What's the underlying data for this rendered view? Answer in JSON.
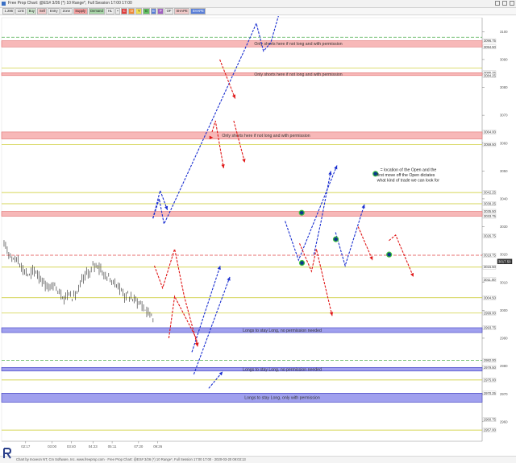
{
  "window": {
    "title": "Free Prop Chart: @ES# 3/26 (*) 10 Range*, Full Session 17:00 17:00"
  },
  "toolbar": [
    {
      "label": "1.286",
      "color": ""
    },
    {
      "label": "Link",
      "color": ""
    },
    {
      "label": "Buy",
      "color": "buy"
    },
    {
      "label": "Sell",
      "color": "sell"
    },
    {
      "label": "Entry",
      "color": ""
    },
    {
      "label": "Zone",
      "color": ""
    },
    {
      "label": "Supply",
      "color": "sup"
    },
    {
      "label": "Demand",
      "color": "dem"
    },
    {
      "label": "HL",
      "color": ""
    },
    {
      "label": "•",
      "color": ""
    },
    {
      "label": "C",
      "color": "red"
    },
    {
      "label": "O",
      "color": "org"
    },
    {
      "label": "Y",
      "color": "yel"
    },
    {
      "label": "G",
      "color": "grn"
    },
    {
      "label": "B",
      "color": "blu"
    },
    {
      "label": "P",
      "color": "pur"
    },
    {
      "label": "OF",
      "color": ""
    },
    {
      "label": "SHAPE",
      "color": "sell"
    },
    {
      "label": "SHAPE",
      "color": "blu"
    }
  ],
  "chart_data": {
    "type": "line",
    "colors": {
      "blue_arrow": "#1a2fd0",
      "red_arrow": "#e01818",
      "supply_zone": "#f7b8b8",
      "demand_zone": "#a0a0ee",
      "level_line": "#c8c820",
      "price": "#222222"
    },
    "price_axis": {
      "min": 2953,
      "max": 3105,
      "current_price": "3017.50"
    },
    "price_tags": [
      "3096.75",
      "3094.50",
      "3085.25",
      "3084.25",
      "3064.00",
      "3059.50",
      "3042.25",
      "3038.25",
      "3035.50",
      "3033.75",
      "3026.75",
      "3019.75",
      "3015.50",
      "3011.00",
      "3004.50",
      "2999.00",
      "2993.75",
      "2982.00",
      "2979.50",
      "2975.00",
      "2970.25",
      "2960.75",
      "2957.00"
    ],
    "axis_ticks": [
      "3100",
      "3090",
      "3080",
      "3070",
      "3060",
      "3050",
      "3040",
      "3030",
      "3020",
      "3010",
      "3000",
      "2990",
      "2980",
      "2970",
      "2960"
    ],
    "time_axis": {
      "labels": [
        "02:17",
        "03:00",
        "03:40",
        "04:23",
        "05:11",
        "07:20",
        "09:26"
      ],
      "positions_pct": [
        5,
        10.5,
        14.5,
        19,
        23,
        28.5,
        32.5
      ]
    },
    "zones": [
      {
        "type": "supply",
        "top": 3096.75,
        "bottom": 3094.5,
        "label": "Only shorts here if not long and with permission"
      },
      {
        "type": "supply",
        "top": 3085.25,
        "bottom": 3084.25,
        "label": "Only shorts here if not long and with permission"
      },
      {
        "type": "supply",
        "top": 3064.0,
        "bottom": 3061.5,
        "label": "Only shorts here if not long and with permission"
      },
      {
        "type": "supply",
        "top": 3035.5,
        "bottom": 3033.75,
        "label": ""
      },
      {
        "type": "demand",
        "top": 2993.75,
        "bottom": 2992.0,
        "label": "Longs to stay Long, no permission needed"
      },
      {
        "type": "demand",
        "top": 2979.5,
        "bottom": 2978.2,
        "label": "Longs to stay Long, no permission needed"
      },
      {
        "type": "demand",
        "top": 2970.25,
        "bottom": 2967.0,
        "label": "Longs to stay Long, only with permission"
      }
    ],
    "levels": [
      {
        "price": 3098.0,
        "style": "dash-green"
      },
      {
        "price": 3087.0,
        "style": "solid-yellow"
      },
      {
        "price": 3059.5,
        "style": "solid-yellow"
      },
      {
        "price": 3042.25,
        "style": "solid-yellow"
      },
      {
        "price": 3038.25,
        "style": "solid-yellow"
      },
      {
        "price": 3019.75,
        "style": "dash-red"
      },
      {
        "price": 3015.5,
        "style": "solid-yellow"
      },
      {
        "price": 3004.5,
        "style": "solid-yellow"
      },
      {
        "price": 2999.0,
        "style": "solid-yellow"
      },
      {
        "price": 2982.0,
        "style": "dash-green"
      },
      {
        "price": 2975.0,
        "style": "solid-yellow"
      },
      {
        "price": 2957.0,
        "style": "solid-yellow"
      }
    ],
    "blue_arrows": [
      [
        [
          0.315,
          3033
        ],
        [
          0.328,
          3040
        ],
        [
          0.338,
          3031
        ],
        [
          0.352,
          3036
        ],
        [
          0.515,
          3097
        ],
        [
          0.53,
          3103
        ],
        [
          0.545,
          3093
        ],
        [
          0.56,
          3096
        ],
        [
          0.61,
          3126
        ]
      ],
      [
        [
          0.315,
          3033
        ],
        [
          0.33,
          3043
        ],
        [
          0.345,
          3036
        ]
      ],
      [
        [
          0.396,
          2985
        ],
        [
          0.455,
          3016
        ]
      ],
      [
        [
          0.4,
          2977
        ],
        [
          0.475,
          3012
        ]
      ],
      [
        [
          0.431,
          2972
        ],
        [
          0.46,
          2978
        ]
      ],
      [
        [
          0.59,
          3032
        ],
        [
          0.618,
          3018
        ],
        [
          0.698,
          3052
        ]
      ],
      [
        [
          0.695,
          3028
        ],
        [
          0.715,
          3016
        ],
        [
          0.755,
          3038
        ]
      ],
      [
        [
          0.65,
          3020
        ],
        [
          0.665,
          3032
        ],
        [
          0.685,
          3050
        ]
      ]
    ],
    "red_arrows": [
      [
        [
          0.318,
          3016
        ],
        [
          0.335,
          3008
        ],
        [
          0.36,
          3022
        ],
        [
          0.38,
          3005
        ],
        [
          0.408,
          2987
        ]
      ],
      [
        [
          0.454,
          3090
        ],
        [
          0.486,
          3076
        ]
      ],
      [
        [
          0.483,
          3068
        ],
        [
          0.506,
          3053
        ]
      ],
      [
        [
          0.44,
          3062
        ],
        [
          0.44,
          3062
        ]
      ],
      [
        [
          0.438,
          3064
        ],
        [
          0.445,
          3068
        ],
        [
          0.462,
          3051
        ]
      ],
      [
        [
          0.62,
          3024
        ],
        [
          0.645,
          3014
        ],
        [
          0.655,
          3022
        ],
        [
          0.688,
          2998
        ]
      ],
      [
        [
          0.742,
          3030
        ],
        [
          0.772,
          3018
        ]
      ],
      [
        [
          0.806,
          3025
        ],
        [
          0.82,
          3027
        ],
        [
          0.857,
          3012
        ]
      ],
      [
        [
          0.348,
          2990
        ],
        [
          0.36,
          3005
        ],
        [
          0.405,
          2990
        ],
        [
          0.408,
          2987
        ]
      ]
    ],
    "markers": [
      {
        "x": 0.6245,
        "price": 3035.0
      },
      {
        "x": 0.6955,
        "price": 3025.5
      },
      {
        "x": 0.625,
        "price": 3017.0
      },
      {
        "x": 0.8065,
        "price": 3020.0
      },
      {
        "x": 0.778,
        "price": 3049.0
      }
    ],
    "legend_note": "= location of the Open and the first move off the Open dictates what kind of trade we can look for"
  },
  "footer": {
    "text": "Chart by Inoveon NT, Cm Software, Inc. www.freeprop.com · Free Prop Chart: @ES# 3/26 (*) 10 Range*, Full Session 17:00 17:00 · 2020-03-20 09:03:13"
  }
}
